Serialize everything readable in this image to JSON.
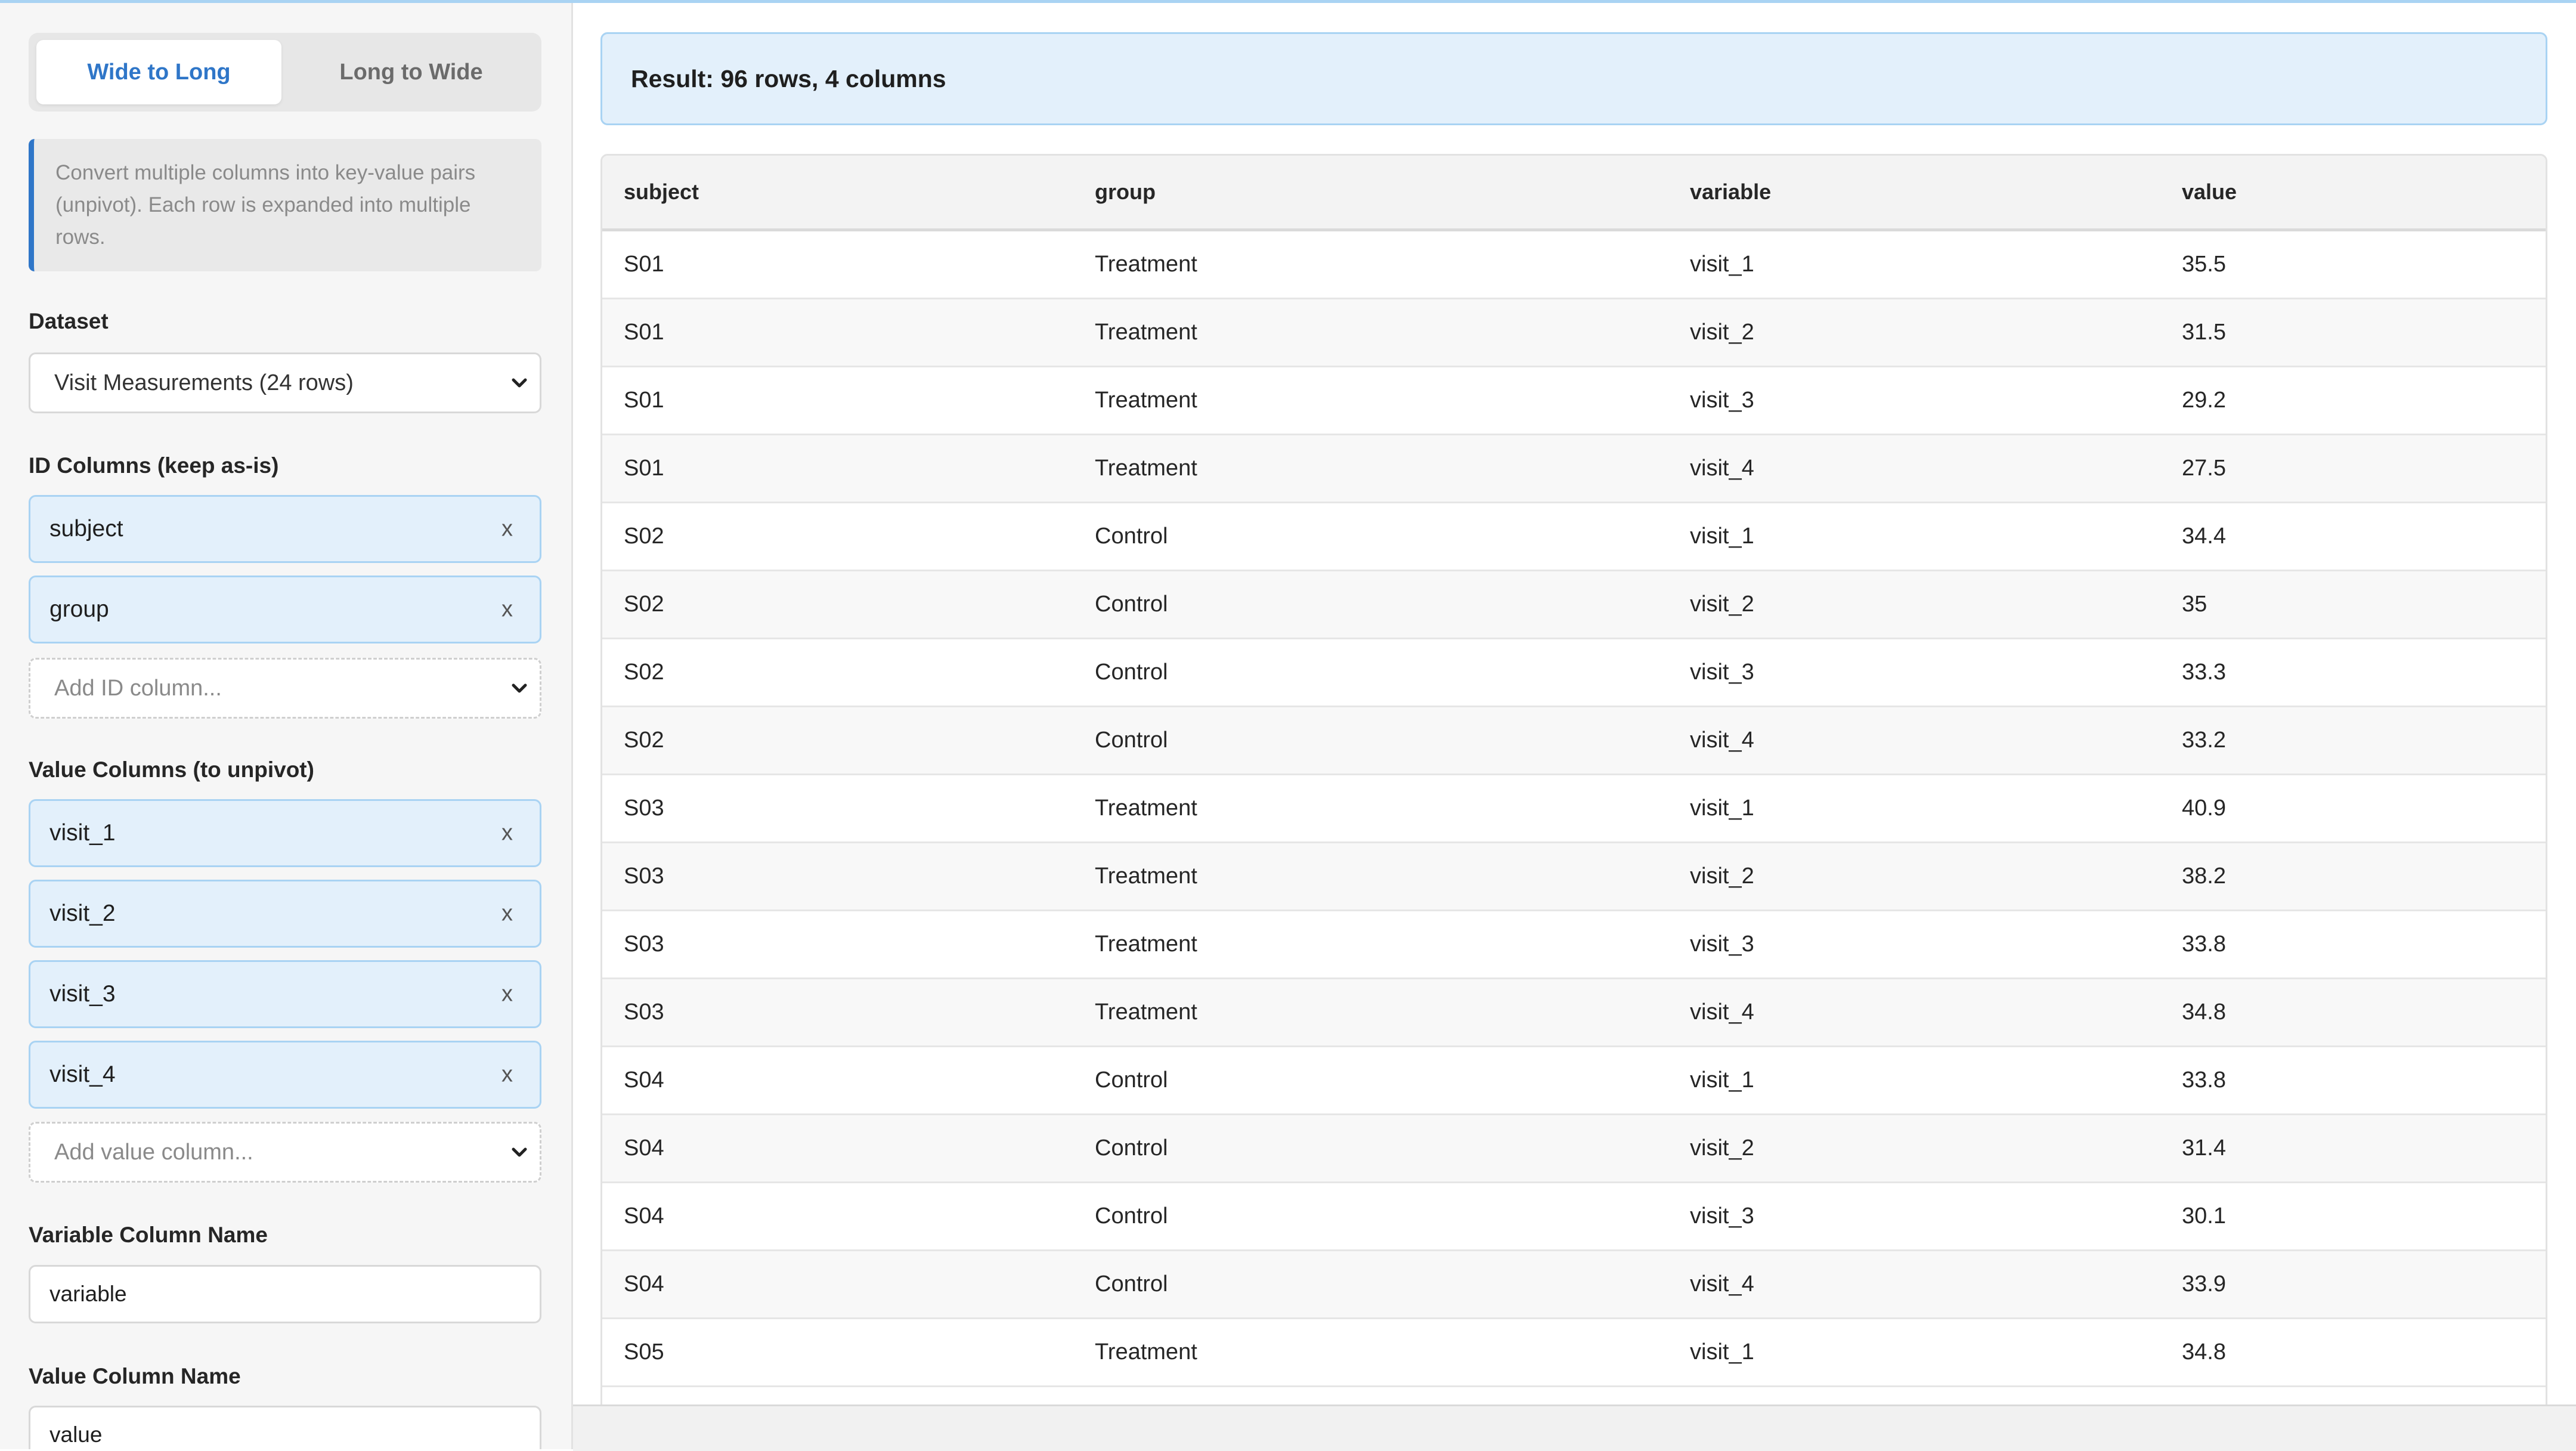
{
  "mode_toggle": {
    "active": "Wide to Long",
    "inactive": "Long to Wide"
  },
  "info": "Convert multiple columns into key-value pairs (unpivot). Each row is expanded into multiple rows.",
  "dataset": {
    "label": "Dataset",
    "selected": "Visit Measurements (24 rows)"
  },
  "id_columns": {
    "label": "ID Columns (keep as-is)",
    "chips": [
      "subject",
      "group"
    ],
    "add_placeholder": "Add ID column..."
  },
  "value_columns": {
    "label": "Value Columns (to unpivot)",
    "chips": [
      "visit_1",
      "visit_2",
      "visit_3",
      "visit_4"
    ],
    "add_placeholder": "Add value column..."
  },
  "variable_name": {
    "label": "Variable Column Name",
    "value": "variable"
  },
  "value_name": {
    "label": "Value Column Name",
    "value": "value"
  },
  "remove_glyph": "x",
  "result": {
    "summary": "Result: 96 rows, 4 columns"
  },
  "table": {
    "columns": [
      "subject",
      "group",
      "variable",
      "value"
    ],
    "rows": [
      [
        "S01",
        "Treatment",
        "visit_1",
        "35.5"
      ],
      [
        "S01",
        "Treatment",
        "visit_2",
        "31.5"
      ],
      [
        "S01",
        "Treatment",
        "visit_3",
        "29.2"
      ],
      [
        "S01",
        "Treatment",
        "visit_4",
        "27.5"
      ],
      [
        "S02",
        "Control",
        "visit_1",
        "34.4"
      ],
      [
        "S02",
        "Control",
        "visit_2",
        "35"
      ],
      [
        "S02",
        "Control",
        "visit_3",
        "33.3"
      ],
      [
        "S02",
        "Control",
        "visit_4",
        "33.2"
      ],
      [
        "S03",
        "Treatment",
        "visit_1",
        "40.9"
      ],
      [
        "S03",
        "Treatment",
        "visit_2",
        "38.2"
      ],
      [
        "S03",
        "Treatment",
        "visit_3",
        "33.8"
      ],
      [
        "S03",
        "Treatment",
        "visit_4",
        "34.8"
      ],
      [
        "S04",
        "Control",
        "visit_1",
        "33.8"
      ],
      [
        "S04",
        "Control",
        "visit_2",
        "31.4"
      ],
      [
        "S04",
        "Control",
        "visit_3",
        "30.1"
      ],
      [
        "S04",
        "Control",
        "visit_4",
        "33.9"
      ],
      [
        "S05",
        "Treatment",
        "visit_1",
        "34.8"
      ]
    ]
  },
  "colors": {
    "accent": "#2f76c8",
    "chip_bg": "#e3f0fb",
    "chip_border": "#a9d3f3"
  }
}
